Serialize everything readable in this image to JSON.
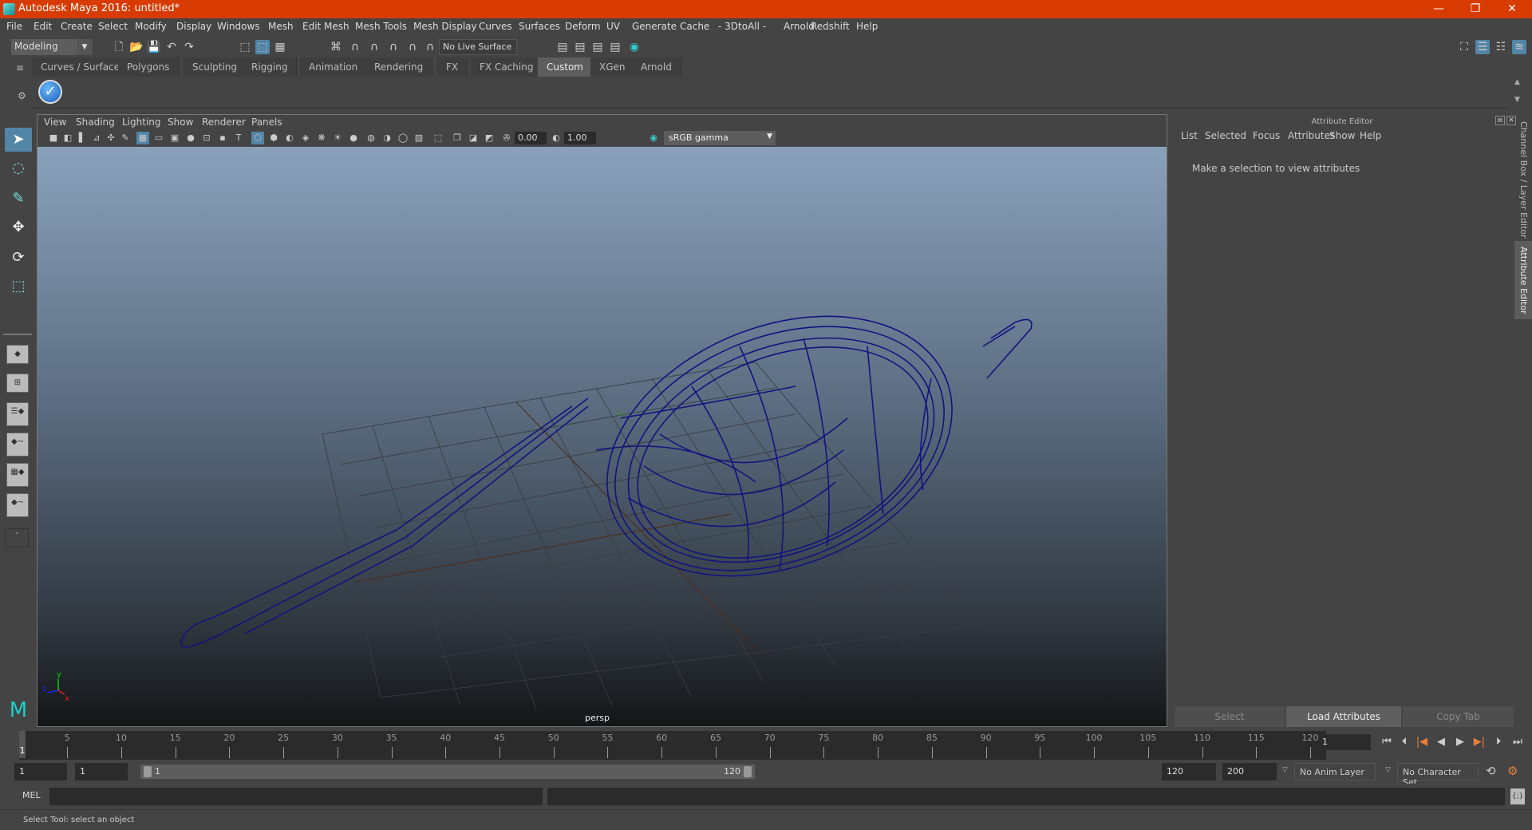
{
  "app": {
    "title": "Autodesk Maya 2016: untitled*",
    "accent": "#d83b01"
  },
  "window_controls": {
    "minimize": "—",
    "restore": "❐",
    "close": "✕"
  },
  "menubar": [
    "File",
    "Edit",
    "Create",
    "Select",
    "Modify",
    "Display",
    "Windows",
    "Mesh",
    "Edit Mesh",
    "Mesh Tools",
    "Mesh Display",
    "Curves",
    "Surfaces",
    "Deform",
    "UV",
    "Generate",
    "Cache",
    "- 3DtoAll -",
    "Arnold",
    "Redshift",
    "Help"
  ],
  "toolbar": {
    "mode": "Modeling",
    "live_surface": "No Live Surface"
  },
  "shelf_tabs": [
    "Curves / Surfaces",
    "Polygons",
    "Sculpting",
    "Rigging",
    "Animation",
    "Rendering",
    "FX",
    "FX Caching",
    "Custom",
    "XGen",
    "Arnold"
  ],
  "shelf_active": "Custom",
  "viewport": {
    "menu": [
      "View",
      "Shading",
      "Lighting",
      "Show",
      "Renderer",
      "Panels"
    ],
    "exposure": "0.00",
    "gamma": "1.00",
    "color_space": "sRGB gamma",
    "camera": "persp",
    "axis": {
      "x": "x",
      "y": "y",
      "z": "z"
    }
  },
  "attribute_editor": {
    "title": "Attribute Editor",
    "menu": [
      "List",
      "Selected",
      "Focus",
      "Attributes",
      "Show",
      "Help"
    ],
    "message": "Make a selection to view attributes",
    "buttons": {
      "select": "Select",
      "load": "Load Attributes",
      "copy": "Copy Tab"
    }
  },
  "side_tabs": {
    "channel_box": "Channel Box / Layer Editor",
    "attribute_editor": "Attribute Editor"
  },
  "timeline": {
    "ticks": [
      "5",
      "10",
      "15",
      "20",
      "25",
      "30",
      "35",
      "40",
      "45",
      "50",
      "55",
      "60",
      "65",
      "70",
      "75",
      "80",
      "85",
      "90",
      "95",
      "100",
      "105",
      "110",
      "115",
      "120"
    ],
    "current": "1",
    "frame_field": "1"
  },
  "range": {
    "start": "1",
    "start2": "1",
    "slider_start": "1",
    "slider_end": "120",
    "end": "120",
    "end2": "200",
    "anim_layer": "No Anim Layer",
    "char_set": "No Character Set"
  },
  "command": {
    "label": "MEL"
  },
  "help_line": "Select Tool: select an object"
}
